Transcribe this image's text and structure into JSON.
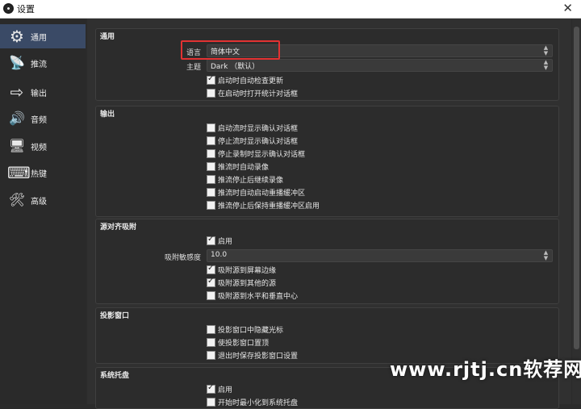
{
  "window": {
    "title": "设置",
    "close_glyph": "✕"
  },
  "sidebar": {
    "items": [
      {
        "label": "通用",
        "icon": "gear-icon",
        "glyph": "⚙",
        "active": true
      },
      {
        "label": "推流",
        "icon": "broadcast-icon",
        "glyph": "📡",
        "active": false
      },
      {
        "label": "输出",
        "icon": "output-icon",
        "glyph": "⇨",
        "active": false
      },
      {
        "label": "音频",
        "icon": "speaker-icon",
        "glyph": "🔊",
        "active": false
      },
      {
        "label": "视频",
        "icon": "monitor-icon",
        "glyph": "🖥",
        "active": false
      },
      {
        "label": "热键",
        "icon": "keyboard-icon",
        "glyph": "⌨",
        "active": false
      },
      {
        "label": "高级",
        "icon": "tools-icon",
        "glyph": "🛠",
        "active": false
      }
    ]
  },
  "general": {
    "title": "通用",
    "language_label": "语言",
    "language_value": "简体中文",
    "theme_label": "主题",
    "theme_value": "Dark （默认）",
    "check_updates": "启动时自动检查更新",
    "check_updates_on": true,
    "open_stats": "在启动时打开统计对话框",
    "open_stats_on": false
  },
  "output": {
    "title": "输出",
    "options": [
      {
        "label": "启动流时显示确认对话框",
        "on": false
      },
      {
        "label": "停止流时显示确认对话框",
        "on": false
      },
      {
        "label": "停止录制时显示确认对话框",
        "on": false
      },
      {
        "label": "推流时自动录像",
        "on": false
      },
      {
        "label": "推流停止后继续录像",
        "on": false
      },
      {
        "label": "推流时自动启动重播缓冲区",
        "on": false
      },
      {
        "label": "推流停止后保持重播缓冲区启用",
        "on": false
      }
    ]
  },
  "snapping": {
    "title": "源对齐吸附",
    "enable": "启用",
    "enable_on": true,
    "sensitivity_label": "吸附敏感度",
    "sensitivity_value": "10.0",
    "options": [
      {
        "label": "吸附源到屏幕边缘",
        "on": true
      },
      {
        "label": "吸附源到其他的源",
        "on": true
      },
      {
        "label": "吸附源到水平和垂直中心",
        "on": false
      }
    ]
  },
  "projector": {
    "title": "投影窗口",
    "options": [
      {
        "label": "投影窗口中隐藏光标",
        "on": false
      },
      {
        "label": "使投影窗口置顶",
        "on": false
      },
      {
        "label": "退出时保存投影窗口设置",
        "on": false
      }
    ]
  },
  "tray": {
    "title": "系统托盘",
    "options": [
      {
        "label": "启用",
        "on": true
      },
      {
        "label": "开始时最小化到系统托盘",
        "on": false
      }
    ]
  },
  "watermark": "www.rjtj.cn软荐网",
  "colors": {
    "accent_active": "#3a4a66",
    "highlight_border": "#e23232"
  }
}
